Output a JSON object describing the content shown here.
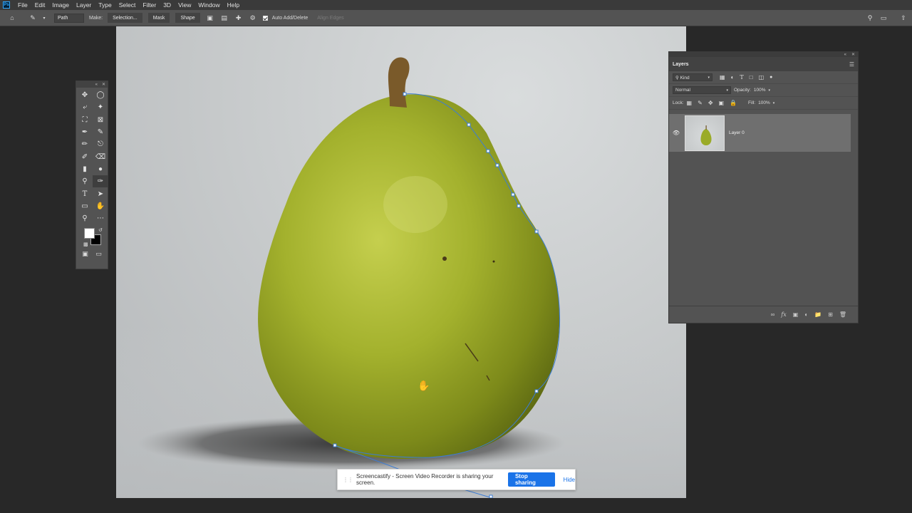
{
  "app": {
    "logo": "Ps"
  },
  "menu": [
    "File",
    "Edit",
    "Image",
    "Layer",
    "Type",
    "Select",
    "Filter",
    "3D",
    "View",
    "Window",
    "Help"
  ],
  "options": {
    "mode": "Path",
    "make_label": "Make:",
    "selection_btn": "Selection...",
    "mask_btn": "Mask",
    "shape_btn": "Shape",
    "auto_add_delete": "Auto Add/Delete",
    "align_edges": "Align Edges"
  },
  "layers": {
    "title": "Layers",
    "filter_kind": "Kind",
    "blend_mode": "Normal",
    "opacity_label": "Opacity:",
    "opacity_value": "100%",
    "lock_label": "Lock:",
    "fill_label": "Fill:",
    "fill_value": "100%",
    "items": [
      {
        "name": "Layer 0",
        "visible": true
      }
    ]
  },
  "share": {
    "message": "Screencastify - Screen Video Recorder is sharing your screen.",
    "stop": "Stop sharing",
    "hide": "Hide"
  },
  "colors": {
    "foreground": "#ffffff",
    "background": "#000000",
    "accent": "#1a73e8",
    "path": "#3b7cd6"
  }
}
